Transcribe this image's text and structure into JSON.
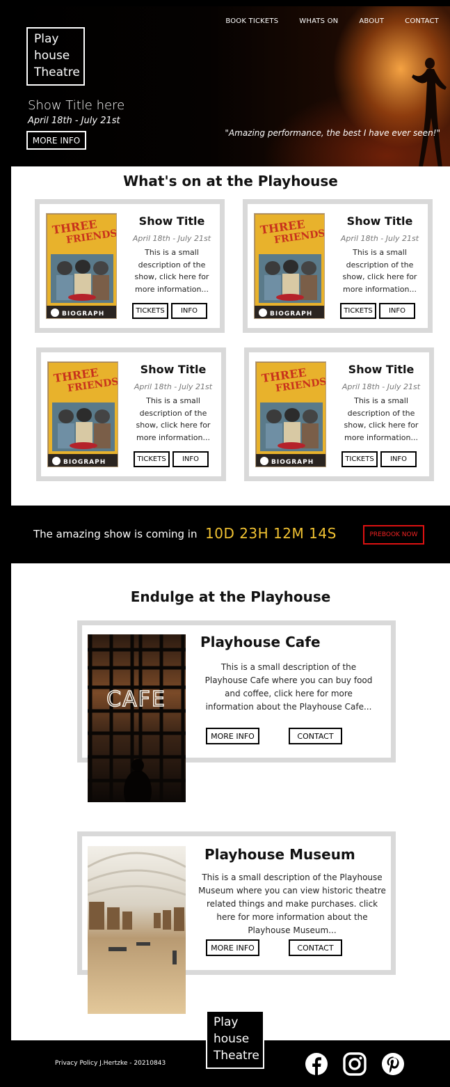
{
  "hero": {
    "logo_lines": [
      "Play",
      "house",
      "Theatre"
    ],
    "nav": [
      "BOOK TICKETS",
      "WHATS ON",
      "ABOUT",
      "CONTACT"
    ],
    "title": "Show Title here",
    "dates": "April 18th - July 21st",
    "button_label": "MORE INFO",
    "quote": "\"Amazing performance, the best I have ever seen!\""
  },
  "whats_on": {
    "heading": "What's on at the Playhouse",
    "cards": [
      {
        "title": "Show Title",
        "dates": "April 18th - July 21st",
        "description": "This is a small description of the show, click here for more information...",
        "tickets_label": "TICKETS",
        "info_label": "INFO"
      },
      {
        "title": "Show Title",
        "dates": "April 18th - July 21st",
        "description": "This is a small description of the show, click here for more information...",
        "tickets_label": "TICKETS",
        "info_label": "INFO"
      },
      {
        "title": "Show Title",
        "dates": "April 18th - July 21st",
        "description": "This is a small description of the show, click here for more information...",
        "tickets_label": "TICKETS",
        "info_label": "INFO"
      },
      {
        "title": "Show Title",
        "dates": "April 18th - July 21st",
        "description": "This is a small description of the show, click here for more information...",
        "tickets_label": "TICKETS",
        "info_label": "INFO"
      }
    ],
    "poster_text": [
      "THREE",
      "FRIENDS",
      "BIOGRAPH"
    ]
  },
  "countdown": {
    "text": "The amazing show is coming in",
    "timer": "10D 23H 12M 14S",
    "button_label": "PREBOOK NOW"
  },
  "endulge": {
    "heading": "Endulge at the Playhouse",
    "venues": [
      {
        "title": "Playhouse Cafe",
        "description": "This is a small description of the Playhouse Cafe where you can buy food and coffee, click here for more information about the Playhouse Cafe...",
        "more_label": "MORE INFO",
        "contact_label": "CONTACT",
        "sign_text": "CAFE"
      },
      {
        "title": "Playhouse Museum",
        "description": "This is a small description of the Playhouse Museum where you can view historic theatre related things and make purchases. click here for more information about the Playhouse Museum...",
        "more_label": "MORE INFO",
        "contact_label": "CONTACT"
      }
    ]
  },
  "footer": {
    "privacy": "Privacy Policy J.Hertzke - 20210843",
    "logo_lines": [
      "Play",
      "house",
      "Theatre"
    ],
    "social_icons": [
      "facebook-icon",
      "instagram-icon",
      "pinterest-icon"
    ]
  },
  "colors": {
    "countdown_timer": "#f1c232",
    "prebook_border": "#dd1111",
    "card_border": "#d9d9d9"
  }
}
